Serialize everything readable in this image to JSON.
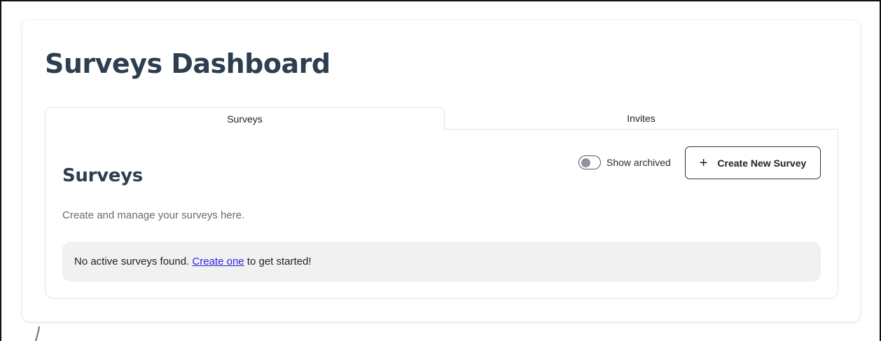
{
  "page": {
    "title": "Surveys Dashboard"
  },
  "tabs": [
    {
      "label": "Surveys",
      "active": true
    },
    {
      "label": "Invites",
      "active": false
    }
  ],
  "surveys_section": {
    "title": "Surveys",
    "description": "Create and manage your surveys here.",
    "show_archived": {
      "label": "Show archived",
      "checked": false
    },
    "create_button": {
      "icon": "plus-icon",
      "label": "Create New Survey"
    },
    "empty_state": {
      "prefix": "No active surveys found. ",
      "link_text": "Create one",
      "suffix": " to get started!"
    }
  },
  "colors": {
    "heading": "#2c3e50",
    "link": "#2f1ee0",
    "empty_bg": "#f1f1f1",
    "border": "#e0e3e8"
  }
}
